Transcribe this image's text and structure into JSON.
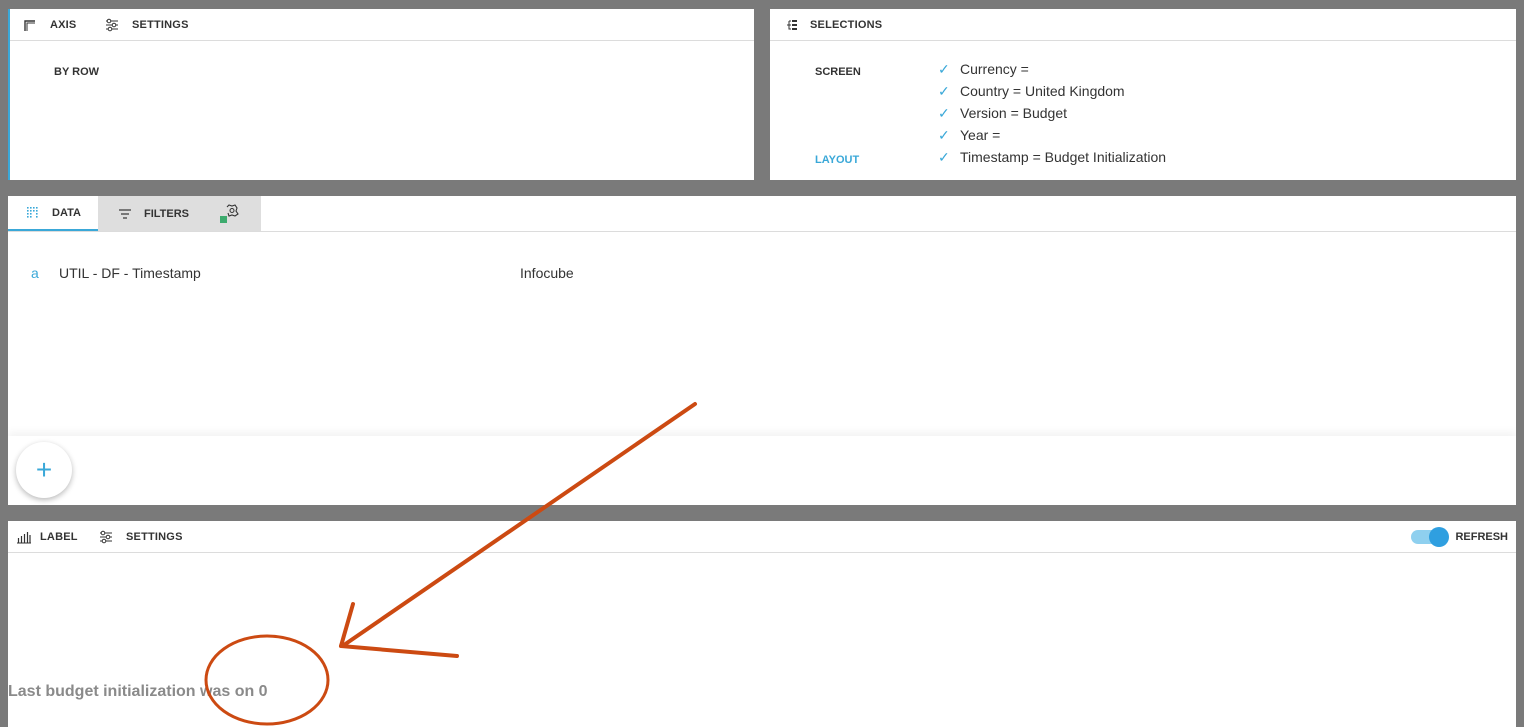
{
  "axis_panel": {
    "tabs": [
      {
        "label": "AXIS",
        "icon": "axis-icon"
      },
      {
        "label": "SETTINGS",
        "icon": "sliders-icon"
      }
    ],
    "by_row": "BY ROW"
  },
  "selections_panel": {
    "title": "SELECTIONS",
    "icon": "selections-tree-icon",
    "screen_label": "SCREEN",
    "layout_label": "LAYOUT",
    "items": [
      "Currency =",
      "Country = United Kingdom",
      "Version = Budget",
      "Year =",
      "Timestamp = Budget Initialization"
    ]
  },
  "data_panel": {
    "tabs": [
      {
        "label": "DATA",
        "icon": "data-grid-icon",
        "active": true
      },
      {
        "label": "FILTERS",
        "icon": "filter-icon",
        "active": false
      },
      {
        "label": "",
        "icon": "settings-plugin-icon",
        "active": false
      }
    ],
    "rows": [
      {
        "type": "a",
        "name": "UTIL - DF - Timestamp",
        "source": "Infocube"
      }
    ],
    "add_button": "+"
  },
  "label_panel": {
    "tabs": [
      {
        "label": "LABEL",
        "icon": "bar-chart-icon"
      },
      {
        "label": "SETTINGS",
        "icon": "sliders-icon"
      }
    ],
    "refresh_label": "REFRESH",
    "refresh_on": true,
    "text": "Last budget initialization was on 0"
  },
  "colors": {
    "accent": "#3aa8d8",
    "annotation": "#cc4a12",
    "background": "#7a7a7a"
  }
}
